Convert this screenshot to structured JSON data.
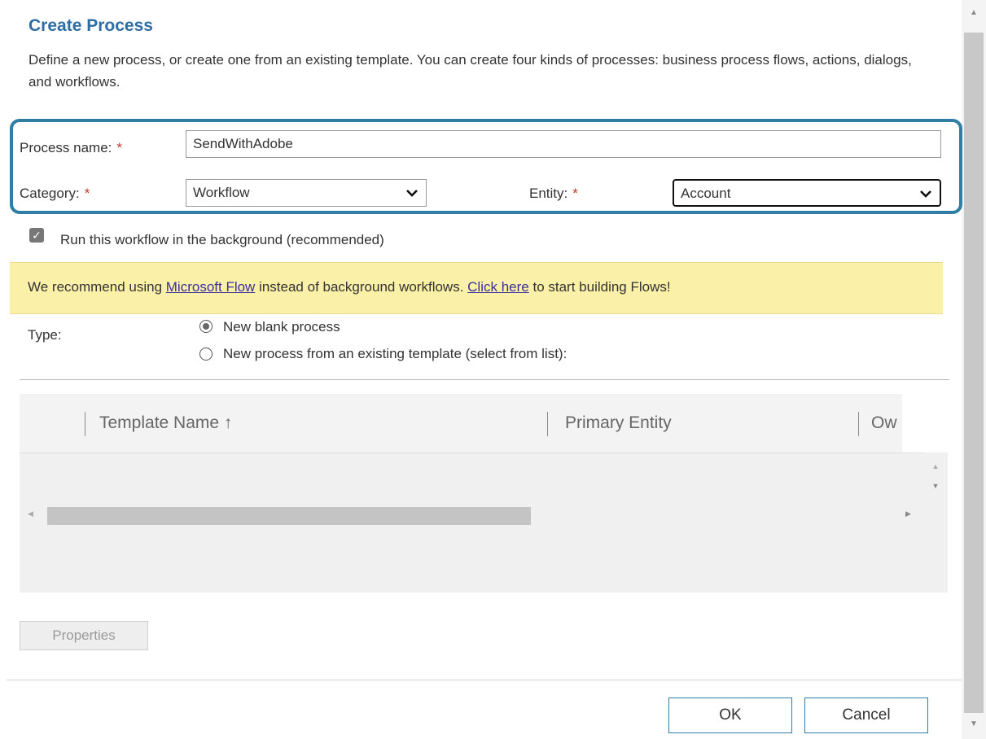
{
  "dialog": {
    "title": "Create Process",
    "description": "Define a new process, or create one from an existing template. You can create four kinds of processes: business process flows, actions, dialogs, and workflows."
  },
  "form": {
    "process_name_label": "Process name:",
    "process_name_value": "SendWithAdobe",
    "category_label": "Category:",
    "category_value": "Workflow",
    "entity_label": "Entity:",
    "entity_value": "Account",
    "required_marker": "*",
    "background_checkbox_label": "Run this workflow in the background (recommended)",
    "background_checked": true
  },
  "banner": {
    "text_before": "We recommend using ",
    "link1": "Microsoft Flow",
    "text_middle": " instead of background workflows. ",
    "link2": "Click here",
    "text_after": " to start building Flows!"
  },
  "type": {
    "label": "Type:",
    "options": [
      "New blank process",
      "New process from an existing template (select from list):"
    ],
    "selected_index": 0
  },
  "template_grid": {
    "columns": [
      "Template Name ↑",
      "Primary Entity",
      "Ow"
    ]
  },
  "buttons": {
    "properties": "Properties",
    "ok": "OK",
    "cancel": "Cancel"
  },
  "icons": {
    "scroll_up": "▲",
    "scroll_down": "▼",
    "scroll_left": "◀",
    "scroll_right": "▶",
    "chevron": "⌄",
    "check": "✓"
  }
}
